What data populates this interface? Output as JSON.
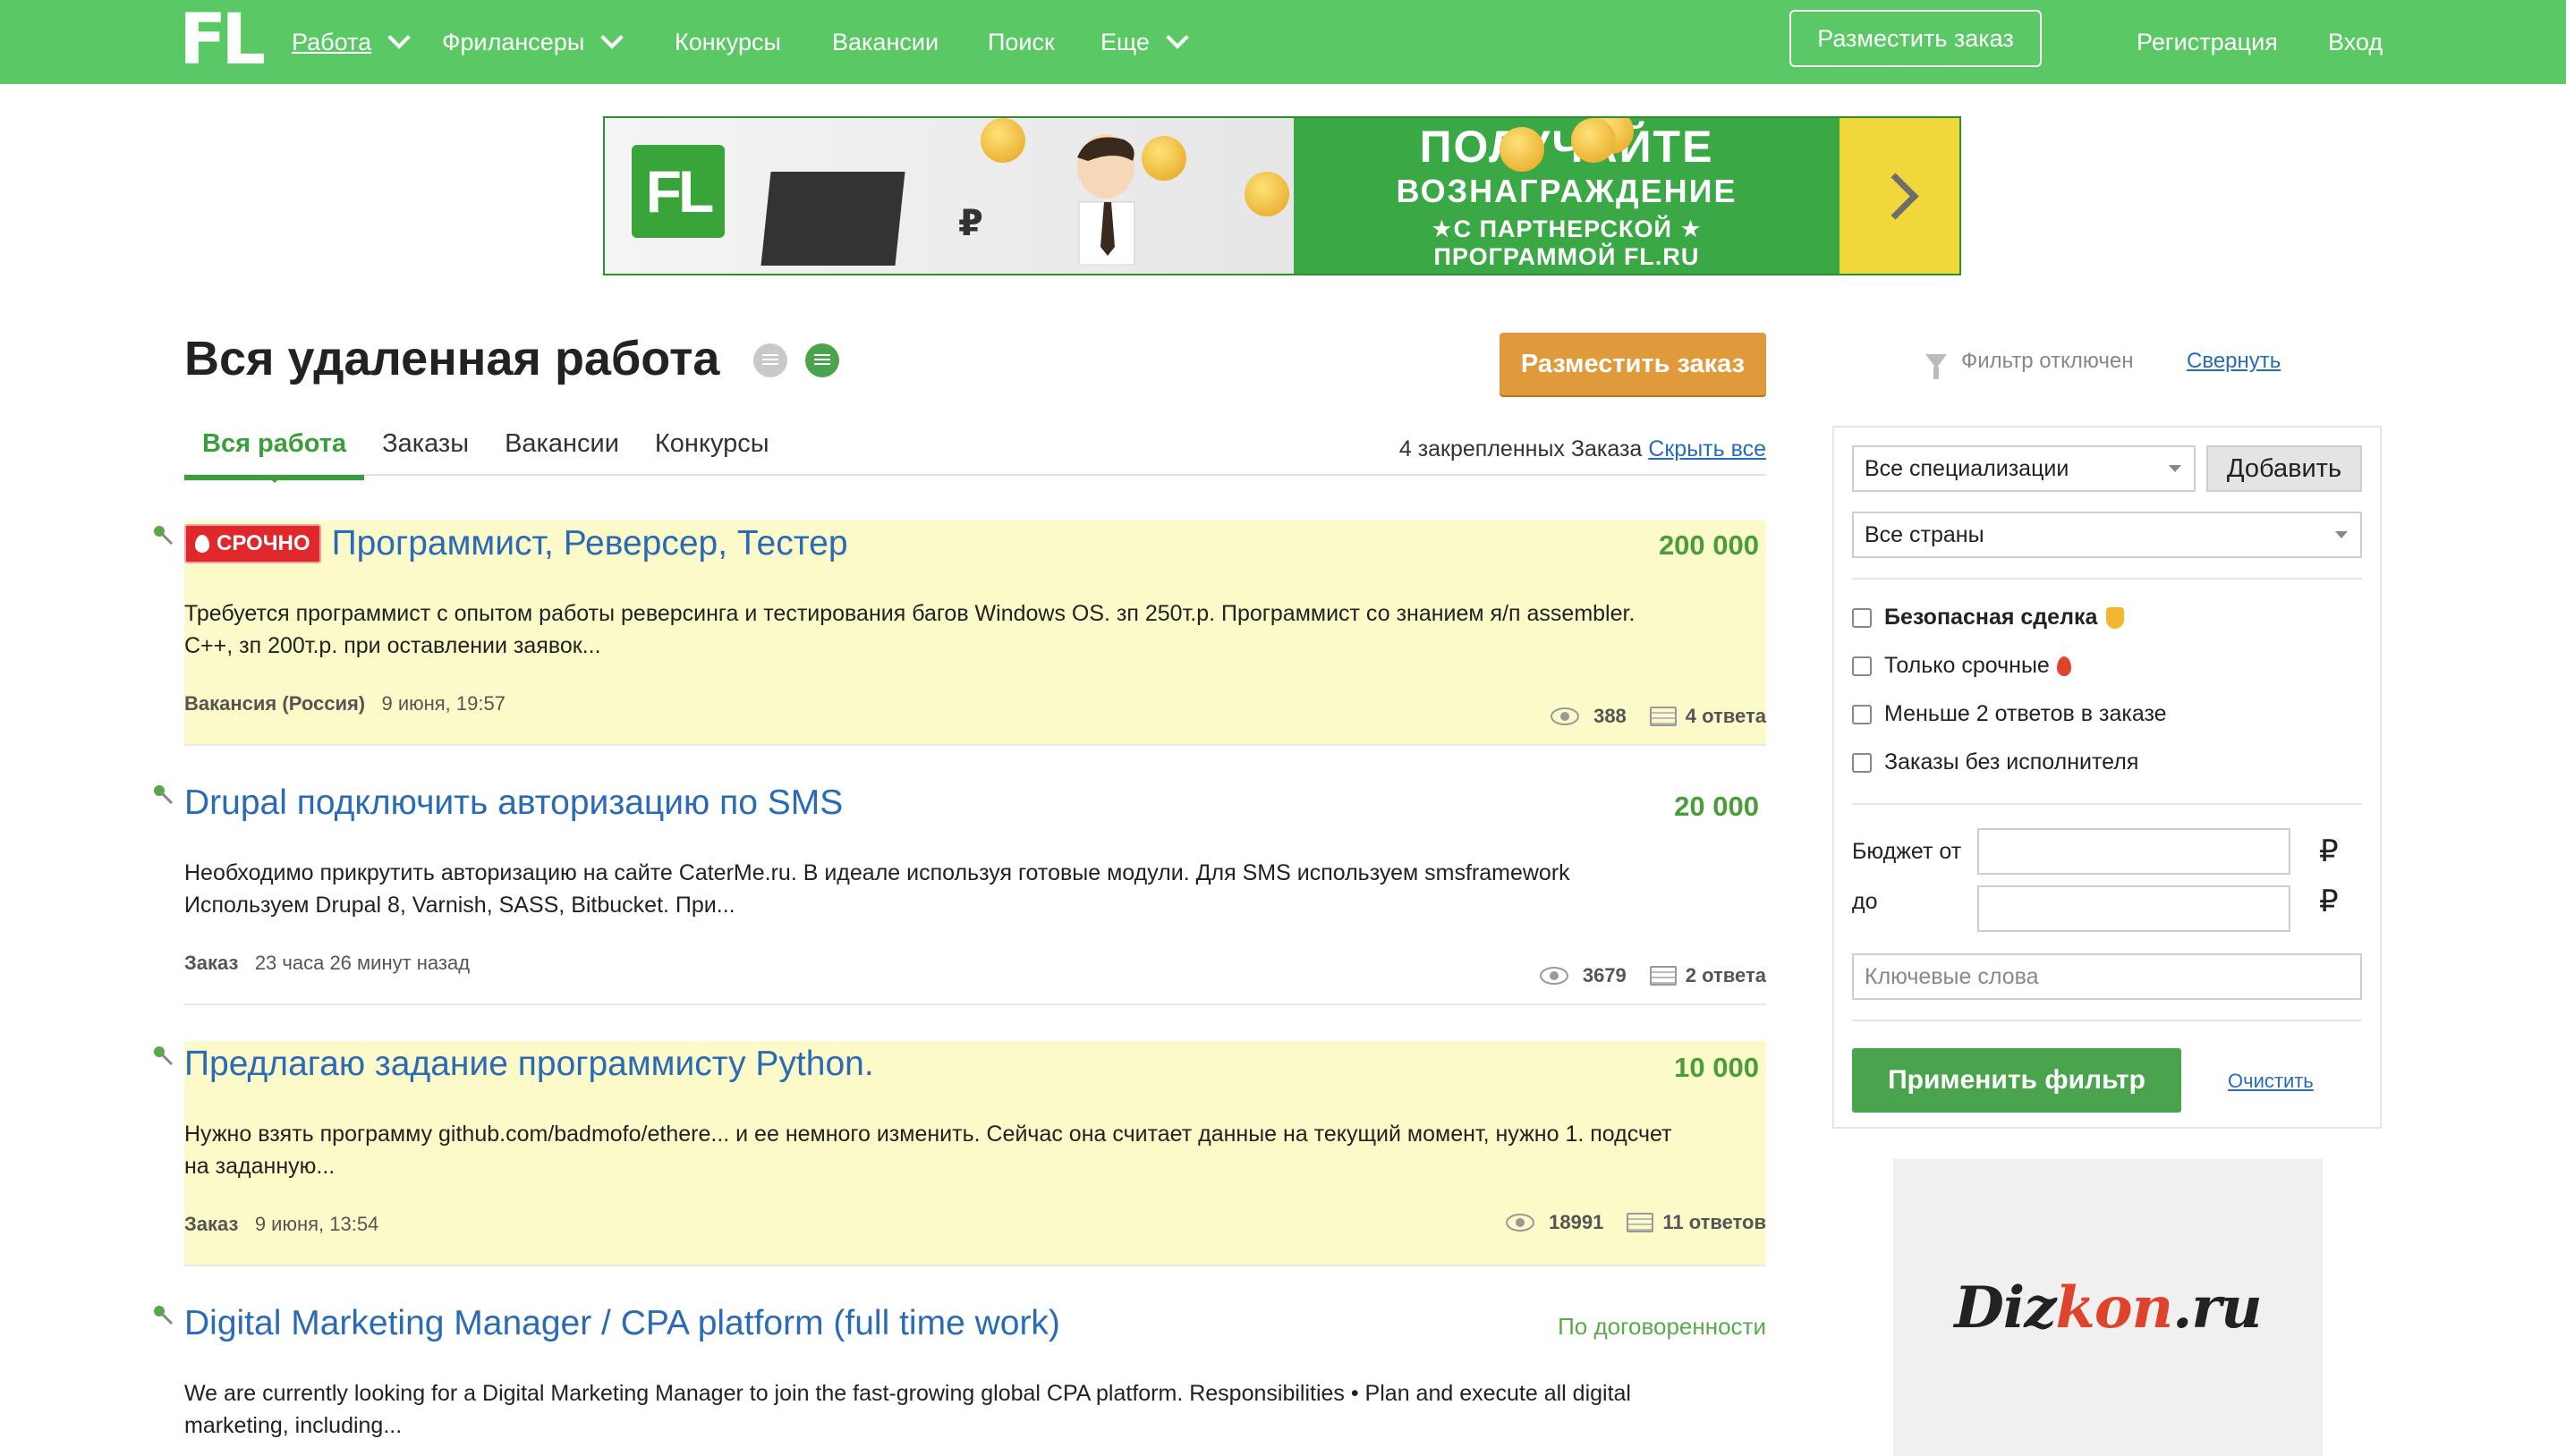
{
  "header": {
    "logo": "FL",
    "nav": [
      {
        "label": "Работа",
        "active": true,
        "dropdown": true
      },
      {
        "label": "Фрилансеры",
        "dropdown": true
      },
      {
        "label": "Конкурсы"
      },
      {
        "label": "Вакансии"
      },
      {
        "label": "Поиск"
      },
      {
        "label": "Еще",
        "dropdown": true
      }
    ],
    "post_button": "Разместить заказ",
    "register": "Регистрация",
    "login": "Вход",
    "color": "#5ac864"
  },
  "banner": {
    "logo": "FL",
    "line1": "ПОЛУЧАЙТЕ",
    "line2": "ВОЗНАГРАЖДЕНИЕ",
    "line3": "★С ПАРТНЕРСКОЙ ★",
    "line4": "ПРОГРАММОЙ FL.RU",
    "currency_glyph": "₽"
  },
  "page": {
    "title": "Вся удаленная работа",
    "post_button": "Разместить заказ",
    "tabs": [
      "Вся работа",
      "Заказы",
      "Вакансии",
      "Конкурсы"
    ],
    "active_tab": "Вся работа",
    "pinned_text": "4 закрепленных Заказа",
    "pinned_link": "Скрыть все"
  },
  "jobs": [
    {
      "urgent_label": "СРОЧНО",
      "title": "Программист, Реверсер, Тестер",
      "price": "200 000",
      "desc_line1": "Требуется программист с опытом работы реверсинга и тестирования багов Windows OS. зп 250т.р. Программист со знанием я/п assembler.",
      "desc_line2": "С++, зп 200т.р. при оставлении заявок...",
      "type": "Вакансия (Россия)",
      "date": "9 июня, 19:57",
      "views": "388",
      "answers": "4 ответа",
      "highlight": true
    },
    {
      "title": "Drupal подключить авторизацию по SMS",
      "price": "20 000",
      "desc_line1": "Необходимо прикрутить авторизацию на сайте CaterMe.ru.  В идеале используя готовые модули. Для SMS используем smsframework",
      "desc_line2": "Используем Drupal 8, Varnish, SASS, Bitbucket. При...",
      "type": "Заказ",
      "date": "23 часа 26 минут назад",
      "views": "3679",
      "answers": "2 ответа",
      "highlight": false
    },
    {
      "title": "Предлагаю задание программисту Python.",
      "price": "10 000",
      "desc_line1": "Нужно взять программу github.com/badmofo/ethere... и ее немного изменить. Сейчас она считает данные на текущий момент, нужно  1. подсчет",
      "desc_line2": "на заданную...",
      "type": "Заказ",
      "date": "9 июня, 13:54",
      "views": "18991",
      "answers": "11 ответов",
      "highlight": true
    },
    {
      "title": "Digital Marketing Manager / CPA platform (full time work)",
      "price": "По договоренности",
      "desc_line1": "We are currently looking for a Digital Marketing Manager to join the fast-growing global CPA platform.  Responsibilities  • Plan and execute all digital",
      "desc_line2": "marketing, including...",
      "highlight": false
    }
  ],
  "filter": {
    "status": "Фильтр отключен",
    "collapse": "Свернуть",
    "specialization": "Все специализации",
    "add_button": "Добавить",
    "country": "Все страны",
    "checks": [
      "Безопасная сделка",
      "Только срочные",
      "Меньше 2 ответов в заказе",
      "Заказы без исполнителя"
    ],
    "budget_from": "Бюджет от",
    "budget_to": "до",
    "currency": "₽",
    "keywords_placeholder": "Ключевые слова",
    "apply": "Применить фильтр",
    "clear": "Очистить"
  },
  "ad": {
    "brand_part1": "Diz",
    "brand_part2": "kon",
    "brand_part3": ".ru"
  }
}
